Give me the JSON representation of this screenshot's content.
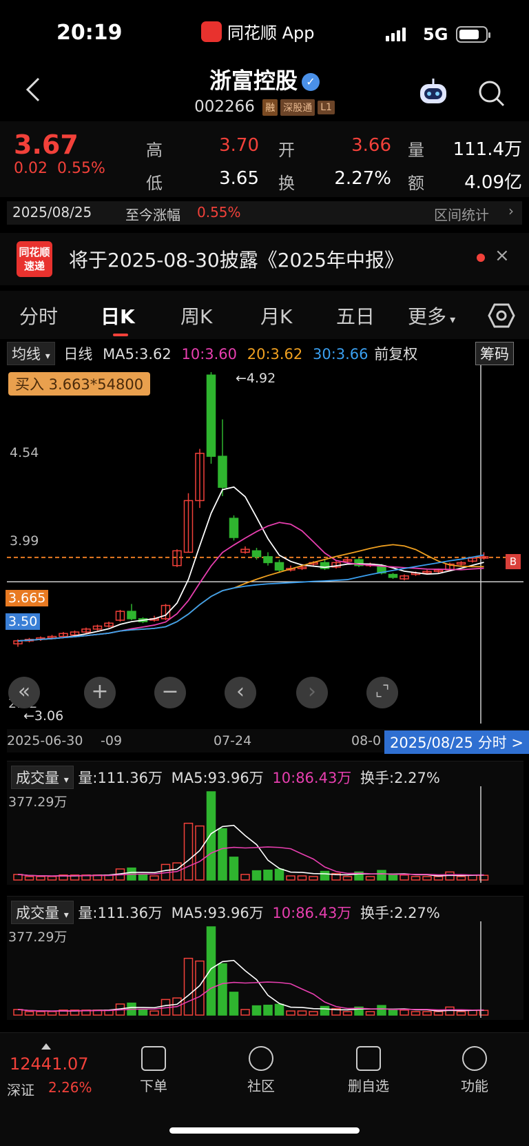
{
  "status": {
    "time": "20:19",
    "app": "同花顺 App",
    "network": "5G"
  },
  "header": {
    "name": "浙富控股",
    "code": "002266",
    "tags": [
      "融",
      "深股通",
      "L1"
    ]
  },
  "quote": {
    "price": "3.67",
    "change": "0.02",
    "change_pct": "0.55%",
    "high_label": "高",
    "high": "3.70",
    "open_label": "开",
    "open": "3.66",
    "vol_label": "量",
    "vol": "111.4万",
    "low_label": "低",
    "low": "3.65",
    "turn_label": "换",
    "turn": "2.27%",
    "amt_label": "额",
    "amt": "4.09亿",
    "date": "2025/08/25",
    "since_label": "至今涨幅",
    "since": "0.55%",
    "range_stat": "区间统计"
  },
  "notice": {
    "logo_top": "同花顺",
    "logo_bottom": "速递",
    "text": "将于2025-08-30披露《2025年中报》"
  },
  "tabs": [
    "分时",
    "日K",
    "周K",
    "月K",
    "五日",
    "更多"
  ],
  "ma": {
    "chip": "均线",
    "period": "日线",
    "ma5": "MA5:3.62",
    "ma10": "10:3.60",
    "ma20": "20:3.62",
    "ma30": "30:3.66",
    "adj": "前复权",
    "chips_btn": "筹码"
  },
  "chart": {
    "buy": "买入 3.663*54800",
    "max": "←4.92",
    "min": "←3.06",
    "y1": "4.54",
    "y2": "3.99",
    "cur": "3.665",
    "crosshair": "3.50",
    "y_low": "2.82",
    "x_labels": [
      "2025-06-30",
      "-09",
      "07-24",
      "08-0"
    ],
    "fenshi": "2025/08/25 分时 >",
    "b_marker": "B",
    "colors": {
      "up": "#f2413a",
      "down": "#2fb52f",
      "ma5": "#ffffff",
      "ma10": "#e83fb0",
      "ma20": "#f0a020",
      "ma30": "#3a9ff0"
    }
  },
  "chart_data": {
    "type": "candlestick",
    "ylim": [
      2.82,
      4.92
    ],
    "candles": [
      [
        3.08,
        3.1,
        3.06,
        3.11
      ],
      [
        3.1,
        3.11,
        3.09,
        3.12
      ],
      [
        3.11,
        3.12,
        3.1,
        3.13
      ],
      [
        3.12,
        3.13,
        3.11,
        3.14
      ],
      [
        3.13,
        3.15,
        3.12,
        3.16
      ],
      [
        3.14,
        3.16,
        3.13,
        3.17
      ],
      [
        3.16,
        3.18,
        3.15,
        3.19
      ],
      [
        3.18,
        3.2,
        3.17,
        3.21
      ],
      [
        3.2,
        3.22,
        3.19,
        3.23
      ],
      [
        3.24,
        3.3,
        3.23,
        3.31
      ],
      [
        3.3,
        3.25,
        3.24,
        3.35
      ],
      [
        3.25,
        3.23,
        3.22,
        3.26
      ],
      [
        3.24,
        3.25,
        3.23,
        3.27
      ],
      [
        3.25,
        3.34,
        3.24,
        3.35
      ],
      [
        3.61,
        3.71,
        3.6,
        3.72
      ],
      [
        3.7,
        4.05,
        3.7,
        4.1
      ],
      [
        4.05,
        4.37,
        4.0,
        4.4
      ],
      [
        4.9,
        4.35,
        4.3,
        4.92
      ],
      [
        4.35,
        4.14,
        4.08,
        4.6
      ],
      [
        3.93,
        3.8,
        3.78,
        3.95
      ],
      [
        3.7,
        3.72,
        3.69,
        3.74
      ],
      [
        3.71,
        3.67,
        3.65,
        3.73
      ],
      [
        3.67,
        3.63,
        3.61,
        3.7
      ],
      [
        3.63,
        3.58,
        3.56,
        3.65
      ],
      [
        3.58,
        3.59,
        3.57,
        3.61
      ],
      [
        3.59,
        3.6,
        3.58,
        3.62
      ],
      [
        3.62,
        3.63,
        3.61,
        3.64
      ],
      [
        3.63,
        3.59,
        3.58,
        3.65
      ],
      [
        3.6,
        3.63,
        3.59,
        3.64
      ],
      [
        3.64,
        3.65,
        3.63,
        3.66
      ],
      [
        3.65,
        3.61,
        3.6,
        3.66
      ],
      [
        3.61,
        3.62,
        3.6,
        3.63
      ],
      [
        3.61,
        3.56,
        3.55,
        3.62
      ],
      [
        3.55,
        3.53,
        3.52,
        3.56
      ],
      [
        3.52,
        3.54,
        3.51,
        3.55
      ],
      [
        3.55,
        3.56,
        3.54,
        3.57
      ],
      [
        3.56,
        3.57,
        3.55,
        3.58
      ],
      [
        3.57,
        3.58,
        3.56,
        3.59
      ],
      [
        3.58,
        3.62,
        3.57,
        3.63
      ],
      [
        3.62,
        3.63,
        3.61,
        3.64
      ],
      [
        3.64,
        3.66,
        3.63,
        3.67
      ],
      [
        3.66,
        3.67,
        3.65,
        3.7
      ]
    ],
    "volume": {
      "label": "成交量",
      "vol": "量:111.36万",
      "ma5": "MA5:93.96万",
      "ma10": "10:86.43万",
      "turnover": "换手:2.27%",
      "axis": "377.29万"
    }
  },
  "bottom": {
    "index_value": "12441.07",
    "index_name": "深证",
    "index_pct": "2.26%",
    "items": [
      "下单",
      "社区",
      "删自选",
      "功能"
    ]
  }
}
